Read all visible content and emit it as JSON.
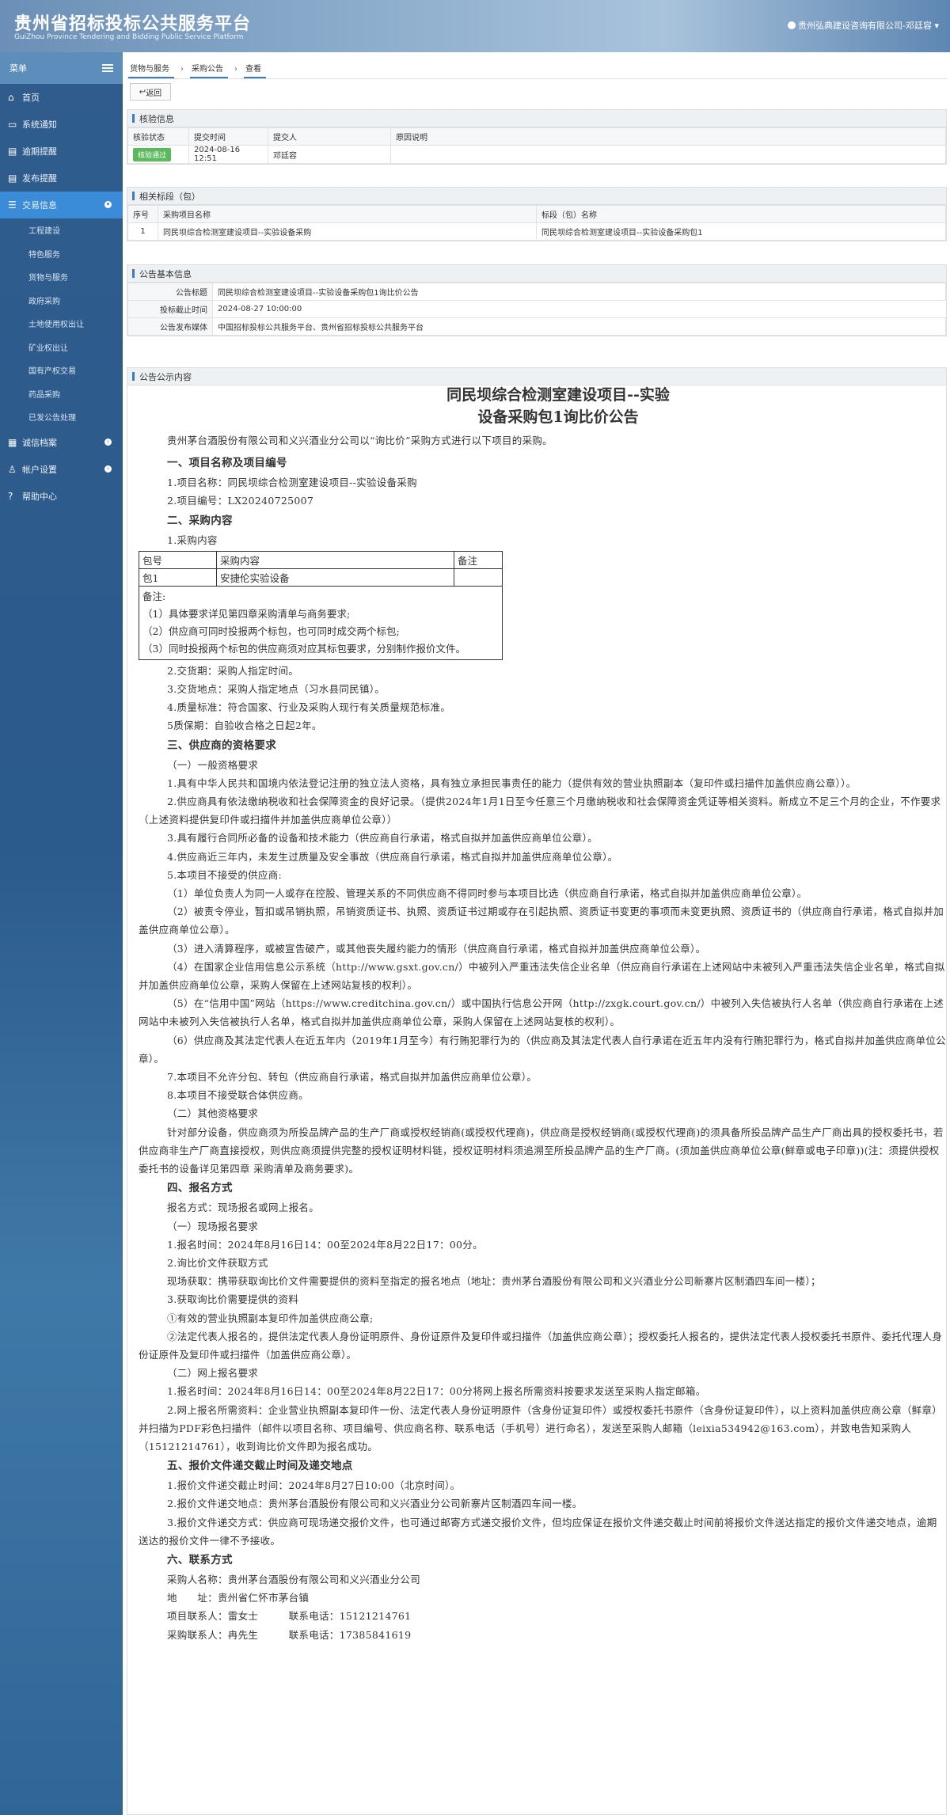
{
  "header": {
    "title_cn": "贵州省招标投标公共服务平台",
    "title_en": "GuiZhou Province Tendering and Bidding Public Service Platform",
    "user": "贵州弘典建设咨询有限公司-邓廷容"
  },
  "sidebar": {
    "menu_label": "菜单",
    "items": [
      {
        "label": "首页"
      },
      {
        "label": "系统通知"
      },
      {
        "label": "逾期提醒"
      },
      {
        "label": "发布提醒"
      },
      {
        "label": "交易信息"
      },
      {
        "label": "诚信档案"
      },
      {
        "label": "帐户设置"
      },
      {
        "label": "帮助中心"
      }
    ],
    "sub_items": [
      "工程建设",
      "特色服务",
      "货物与服务",
      "政府采购",
      "土地使用权出让",
      "矿业权出让",
      "国有产权交易",
      "药品采购",
      "已发公告处理"
    ]
  },
  "breadcrumb": [
    "货物与服务",
    "采购公告",
    "查看"
  ],
  "back_label": "返回",
  "check": {
    "title": "核验信息",
    "headers": [
      "核验状态",
      "提交时间",
      "提交人",
      "原因说明"
    ],
    "status": "核验通过",
    "time": "2024-08-16 12:51",
    "submitter": "邓廷容",
    "reason": ""
  },
  "bids": {
    "title": "相关标段（包）",
    "headers": [
      "序号",
      "采购项目名称",
      "标段（包）名称"
    ],
    "rows": [
      {
        "no": "1",
        "project": "同民坝综合检测室建设项目--实验设备采购",
        "section": "同民坝综合检测室建设项目--实验设备采购包1"
      }
    ]
  },
  "basic": {
    "title": "公告基本信息",
    "rows": [
      {
        "k": "公告标题",
        "v": "同民坝综合检测室建设项目--实验设备采购包1询比价公告"
      },
      {
        "k": "投标截止时间",
        "v": "2024-08-27 10:00:00"
      },
      {
        "k": "公告发布媒体",
        "v": "中国招标投标公共服务平台、贵州省招标投标公共服务平台"
      }
    ]
  },
  "content": {
    "title": "公告公示内容",
    "doc_title_1": "同民坝综合检测室建设项目--实验",
    "doc_title_2": "设备采购包1询比价公告",
    "intro": "贵州茅台酒股份有限公司和义兴酒业分公司以“询比价”采购方式进行以下项目的采购。",
    "s1": "一、项目名称及项目编号",
    "s1_1": "1.项目名称：同民坝综合检测室建设项目--实验设备采购",
    "s1_2": "2.项目编号：LX20240725007",
    "s2": "二、采购内容",
    "s2_1": "1.采购内容",
    "pkg_h1": "包号",
    "pkg_h2": "采购内容",
    "pkg_h3": "备注",
    "pkg_r1": "包1",
    "pkg_r2": "安捷伦实验设备",
    "pkg_r3": "",
    "note_1": "备注:",
    "note_2": "（1）具体要求详见第四章采购清单与商务要求;",
    "note_3": "（2）供应商可同时投报两个标包，也可同时成交两个标包;",
    "note_4": "（3）同时投报两个标包的供应商须对应其标包要求，分别制作报价文件。",
    "s2_2": "2.交货期：采购人指定时间。",
    "s2_3": "3.交货地点：采购人指定地点（习水县同民镇）。",
    "s2_4": "4.质量标准：符合国家、行业及采购人现行有关质量规范标准。",
    "s2_5": "5质保期：自验收合格之日起2年。",
    "s3": "三、供应商的资格要求",
    "s3_a": "（一）一般资格要求",
    "s3_1": "1.具有中华人民共和国境内依法登记注册的独立法人资格，具有独立承担民事责任的能力（提供有效的营业执照副本（复印件或扫描件加盖供应商公章））。",
    "s3_2": "2.供应商具有依法缴纳税收和社会保障资金的良好记录。（提供2024年1月1日至今任意三个月缴纳税收和社会保障资金凭证等相关资料。新成立不足三个月的企业，不作要求（上述资料提供复印件或扫描件并加盖供应商单位公章））",
    "s3_3": "3.具有履行合同所必备的设备和技术能力（供应商自行承诺，格式自拟并加盖供应商单位公章）。",
    "s3_4": "4.供应商近三年内，未发生过质量及安全事故（供应商自行承诺，格式自拟并加盖供应商单位公章）。",
    "s3_5": "5.本项目不接受的供应商:",
    "s3_5_1": "（1）单位负责人为同一人或存在控股、管理关系的不同供应商不得同时参与本项目比选（供应商自行承诺，格式自拟并加盖供应商单位公章）。",
    "s3_5_2": "（2）被责令停业，暂扣或吊销执照，吊销资质证书、执照、资质证书过期或存在引起执照、资质证书变更的事项而未变更执照、资质证书的（供应商自行承诺，格式自拟并加盖供应商单位公章）。",
    "s3_5_3": "（3）进入清算程序，或被宣告破产，或其他丧失履约能力的情形（供应商自行承诺，格式自拟并加盖供应商单位公章）。",
    "s3_5_4": "（4）在国家企业信用信息公示系统（http://www.gsxt.gov.cn/）中被列入严重违法失信企业名单（供应商自行承诺在上述网站中未被列入严重违法失信企业名单，格式自拟并加盖供应商单位公章，采购人保留在上述网站复核的权利）。",
    "s3_5_5": "（5）在“信用中国”网站（https://www.creditchina.gov.cn/）或中国执行信息公开网（http://zxgk.court.gov.cn/）中被列入失信被执行人名单（供应商自行承诺在上述网站中未被列入失信被执行人名单，格式自拟并加盖供应商单位公章，采购人保留在上述网站复核的权利）。",
    "s3_5_6": "（6）供应商及其法定代表人在近五年内（2019年1月至今）有行贿犯罪行为的（供应商及其法定代表人自行承诺在近五年内没有行贿犯罪行为，格式自拟并加盖供应商单位公章）。",
    "s3_7": "7.本项目不允许分包、转包（供应商自行承诺，格式自拟并加盖供应商单位公章）。",
    "s3_8": "8.本项目不接受联合体供应商。",
    "s3_b": "（二）其他资格要求",
    "s3_b_txt": "针对部分设备，供应商须为所投品牌产品的生产厂商或授权经销商(或授权代理商)，供应商是授权经销商(或授权代理商)的须具备所投品牌产品生产厂商出具的授权委托书，若供应商非生产厂商直接授权，则供应商须提供完整的授权证明材料链，授权证明材料须追溯至所投品牌产品的生产厂商。(须加盖供应商单位公章(鲜章或电子印章))(注：须提供授权委托书的设备详见第四章 采购清单及商务要求)。",
    "s4": "四、报名方式",
    "s4_0": "报名方式：现场报名或网上报名。",
    "s4_a": "（一）现场报名要求",
    "s4_1": "1.报名时间：2024年8月16日14：00至2024年8月22日17：00分。",
    "s4_2": "2.询比价文件获取方式",
    "s4_2t": "现场获取：携带获取询比价文件需要提供的资料至指定的报名地点（地址：贵州茅台酒股份有限公司和义兴酒业分公司新寨片区制酒四车间一楼）；",
    "s4_3": "3.获取询比价需要提供的资料",
    "s4_3a": "①有效的营业执照副本复印件加盖供应商公章;",
    "s4_3b": "②法定代表人报名的，提供法定代表人身份证明原件、身份证原件及复印件或扫描件（加盖供应商公章）；授权委托人报名的，提供法定代表人授权委托书原件、委托代理人身份证原件及复印件或扫描件（加盖供应商公章）。",
    "s4_b": "（二）网上报名要求",
    "s4_b1": "1.报名时间：2024年8月16日14：00至2024年8月22日17：00分将网上报名所需资料按要求发送至采购人指定邮箱。",
    "s4_b2": "2.网上报名所需资料：企业营业执照副本复印件一份、法定代表人身份证明原件（含身份证复印件）或授权委托书原件（含身份证复印件），以上资料加盖供应商公章（鲜章）并扫描为PDF彩色扫描件（邮件以项目名称、项目编号、供应商名称、联系电话（手机号）进行命名），发送至采购人邮箱（leixia534942@163.com），并致电告知采购人（15121214761），收到询比价文件即为报名成功。",
    "s5": "五、报价文件递交截止时间及递交地点",
    "s5_1": "1.报价文件递交截止时间：2024年8月27日10:00（北京时间）。",
    "s5_2": "2.报价文件递交地点：贵州茅台酒股份有限公司和义兴酒业分公司新寨片区制酒四车间一楼。",
    "s5_3": "3.报价文件递交方式：供应商可现场递交报价文件，也可通过邮寄方式递交报价文件，但均应保证在报价文件递交截止时间前将报价文件送达指定的报价文件递交地点，逾期送达的报价文件一律不予接收。",
    "s6": "六、联系方式",
    "s6_1": "采购人名称：贵州茅台酒股份有限公司和义兴酒业分公司",
    "s6_2": "地　　址：贵州省仁怀市茅台镇",
    "s6_3": "项目联系人：雷女士　　　联系电话：15121214761",
    "s6_4": "采购联系人：冉先生　　　联系电话：17385841619"
  }
}
